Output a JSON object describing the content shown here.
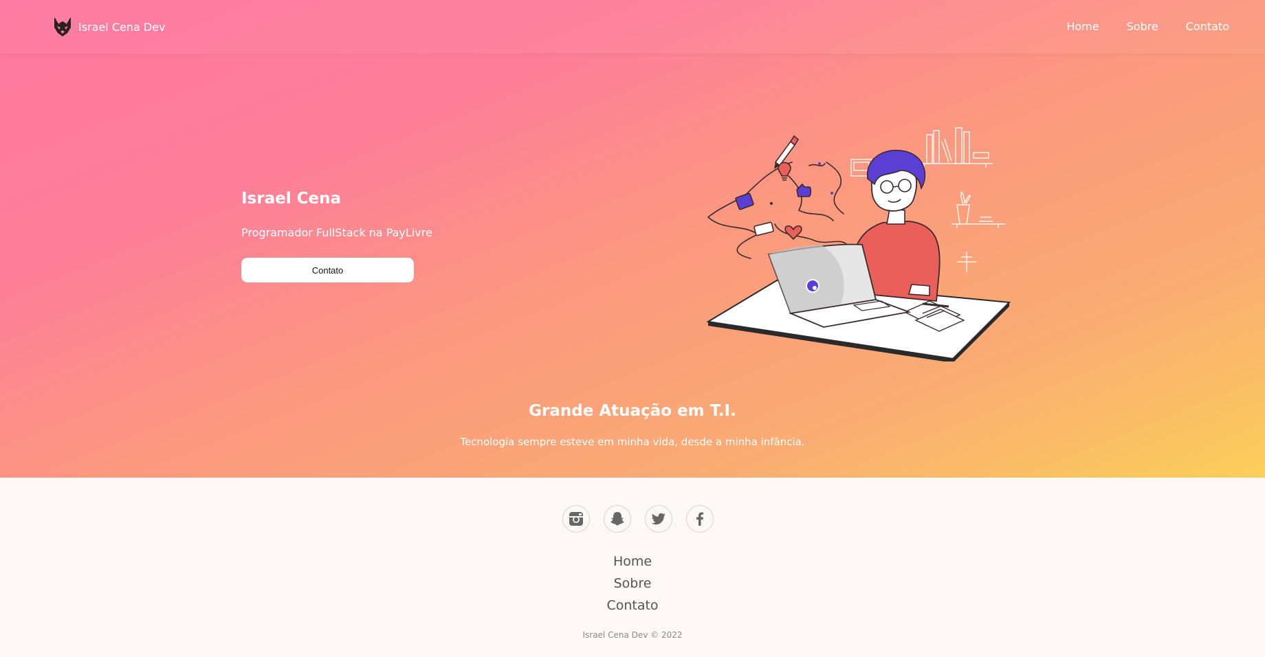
{
  "header": {
    "brand": "Israel Cena Dev",
    "nav": [
      {
        "label": "Home"
      },
      {
        "label": "Sobre"
      },
      {
        "label": "Contato"
      }
    ]
  },
  "hero": {
    "title": "Israel Cena",
    "subtitle": "Programador FullStack na PayLivre",
    "button_label": "Contato"
  },
  "section": {
    "title": "Grande Atuação em T.I.",
    "text": "Tecnologia sempre esteve em minha vida, desde a minha infância."
  },
  "footer": {
    "socials": [
      {
        "icon": "instagram-icon"
      },
      {
        "icon": "snapchat-icon"
      },
      {
        "icon": "twitter-icon"
      },
      {
        "icon": "facebook-icon"
      }
    ],
    "links": [
      {
        "label": "Home"
      },
      {
        "label": "Sobre"
      },
      {
        "label": "Contato"
      }
    ],
    "copyright": "Israel Cena Dev © 2022"
  },
  "colors": {
    "gradient_start": "#fe779f",
    "gradient_mid": "#fb9880",
    "gradient_end": "#fbcf5a",
    "footer_bg": "#fdf8f6",
    "footer_link": "#555555",
    "accent_purple": "#5b3fd3",
    "shirt_red": "#ea5f5a"
  }
}
